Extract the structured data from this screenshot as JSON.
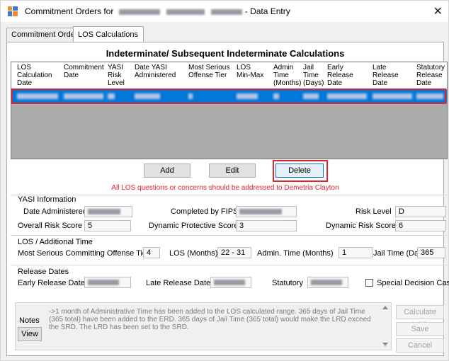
{
  "window": {
    "title_prefix": "Commitment Orders for",
    "title_suffix": "- Data Entry",
    "close_glyph": "✕"
  },
  "tabs": [
    {
      "label": "Commitment Order",
      "active": false
    },
    {
      "label": "LOS Calculations",
      "active": true
    }
  ],
  "grid": {
    "heading": "Indeterminate/ Subsequent Indeterminate Calculations",
    "columns": [
      "LOS\nCalculation\nDate",
      "Commitment\nDate",
      "YASI\nRisk\nLevel",
      "Date YASI\nAdministered",
      "Most Serious\nOffense Tier",
      "LOS\nMin-Max",
      "Admin\nTime\n(Months)",
      "Jail\nTime\n(Days)",
      "Early\nRelease\nDate",
      "Late\nRelease\nDate",
      "Statutory\nRelease\nDate"
    ]
  },
  "buttons": {
    "add": "Add",
    "edit": "Edit",
    "delete": "Delete",
    "view": "View",
    "calculate": "Calculate LOS",
    "save": "Save",
    "cancel": "Cancel"
  },
  "notice": "All LOS questions or concerns should be addressed to Demetria Clayton",
  "yasi": {
    "section": "YASI Information",
    "date_administered_label": "Date Administered",
    "completed_by_label": "Completed by FIPS",
    "risk_level_label": "Risk Level",
    "risk_level": "D",
    "overall_risk_label": "Overall Risk Score",
    "overall_risk": "5",
    "dynamic_protective_label": "Dynamic Protective Score",
    "dynamic_protective": "3",
    "dynamic_risk_label": "Dynamic Risk Score",
    "dynamic_risk": "6"
  },
  "los": {
    "section": "LOS / Additional Time",
    "offense_tier_label": "Most Serious Committing Offense Tier",
    "offense_tier": "4",
    "los_months_label": "LOS (Months)",
    "los_months": "22 - 31",
    "admin_time_label": "Admin. Time (Months)",
    "admin_time": "1",
    "jail_time_label": "Jail Time (Days)",
    "jail_time": "365"
  },
  "release": {
    "section": "Release Dates",
    "early_label": "Early Release Date",
    "late_label": "Late Release Date",
    "statutory_label": "Statutory",
    "special_label": "Special Decision Case"
  },
  "notes": {
    "label": "Notes",
    "text": "->1 month of Administrative Time has been added to the LOS calculated range. 365 days of Jail Time (365 total) have been added to the ERD. 365 days of Jail Time (365 total) would make the LRD exceed the SRD. The LRD has been set to the SRD."
  }
}
